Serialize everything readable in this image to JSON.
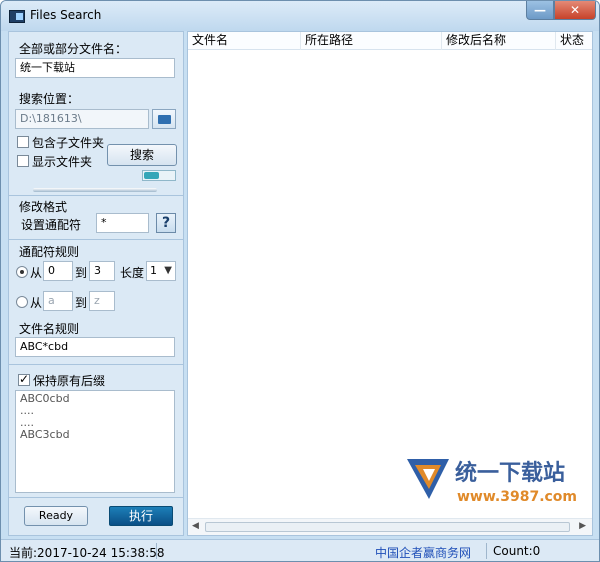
{
  "window": {
    "title": "Files Search",
    "minimize": "—",
    "close": "✕"
  },
  "search": {
    "name_label": "全部或部分文件名：",
    "name_value": "统一下载站",
    "location_label": "搜索位置：",
    "location_value": "D:\\181613\\",
    "include_subfolders": "包含子文件夹",
    "show_folders": "显示文件夹",
    "search_button": "搜索"
  },
  "modify": {
    "section_label": "修改格式",
    "wildcard_label": "设置通配符",
    "wildcard_value": "*",
    "help_button": "?"
  },
  "rules": {
    "section_label": "通配符规则",
    "from_label": "从",
    "from_value": "0",
    "to_label": "到",
    "to_value": "3",
    "length_label": "长度",
    "length_value": "1",
    "from2_label": "从",
    "from2_placeholder": "a",
    "to2_label": "到",
    "to2_placeholder": "z"
  },
  "filename_rule": {
    "label": "文件名规则",
    "value": "ABC*cbd",
    "keep_suffix": "保持原有后缀",
    "preview": [
      "ABC0cbd",
      "....",
      "....",
      "ABC3cbd"
    ]
  },
  "actions": {
    "ready_button": "Ready",
    "execute_button": "执行"
  },
  "grid": {
    "columns": [
      "文件名",
      "所在路径",
      "修改后名称",
      "状态"
    ]
  },
  "watermark": {
    "text": "统一下载站",
    "url": "www.3987.com"
  },
  "statusbar": {
    "current_time": "当前:2017-10-24 15:38:58",
    "link": "中国企者赢商务网",
    "count": "Count:0"
  },
  "colors": {
    "accent": "#0b4f86",
    "link": "#1f4fb8",
    "watermark": "#3a5f9c",
    "watermark_url": "#e08a2a"
  }
}
